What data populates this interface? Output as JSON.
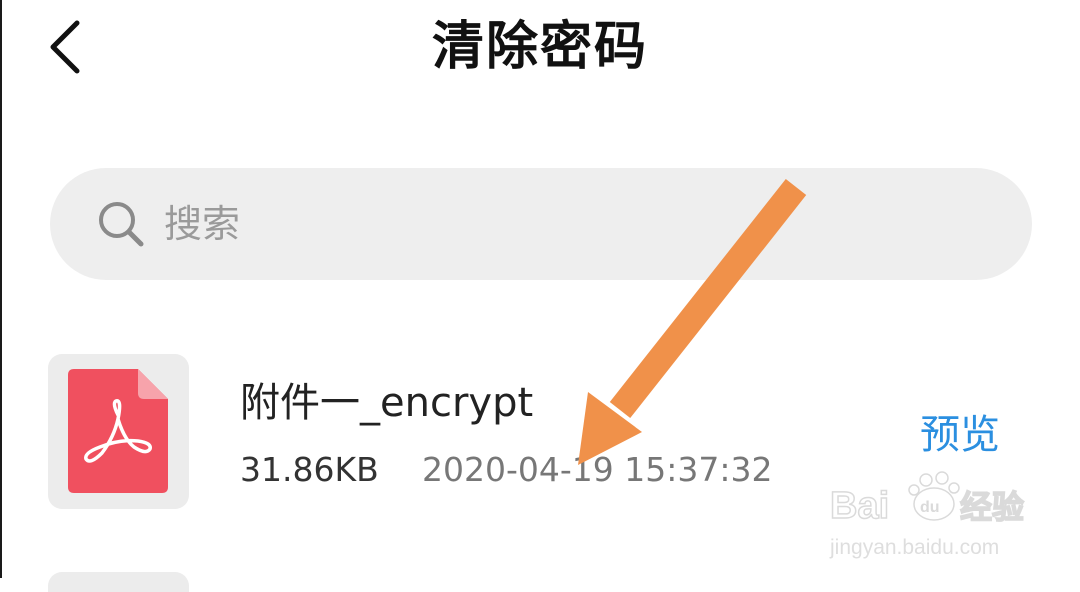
{
  "header": {
    "title": "清除密码",
    "back_icon": "chevron-left-icon"
  },
  "search": {
    "placeholder": "搜索",
    "value": "",
    "icon": "search-icon"
  },
  "files": [
    {
      "name": "附件一_encrypt",
      "size": "31.86KB",
      "date": "2020-04-19 15:37:32",
      "icon": "pdf-file-icon",
      "action_label": "预览"
    }
  ],
  "watermark": {
    "brand": "Bai du 经验",
    "url": "jingyan.baidu.com"
  },
  "colors": {
    "pdf_red": "#f0505f",
    "link_blue": "#2b8fe0",
    "arrow_orange": "#f0914a",
    "search_bg": "#eeeeee"
  }
}
